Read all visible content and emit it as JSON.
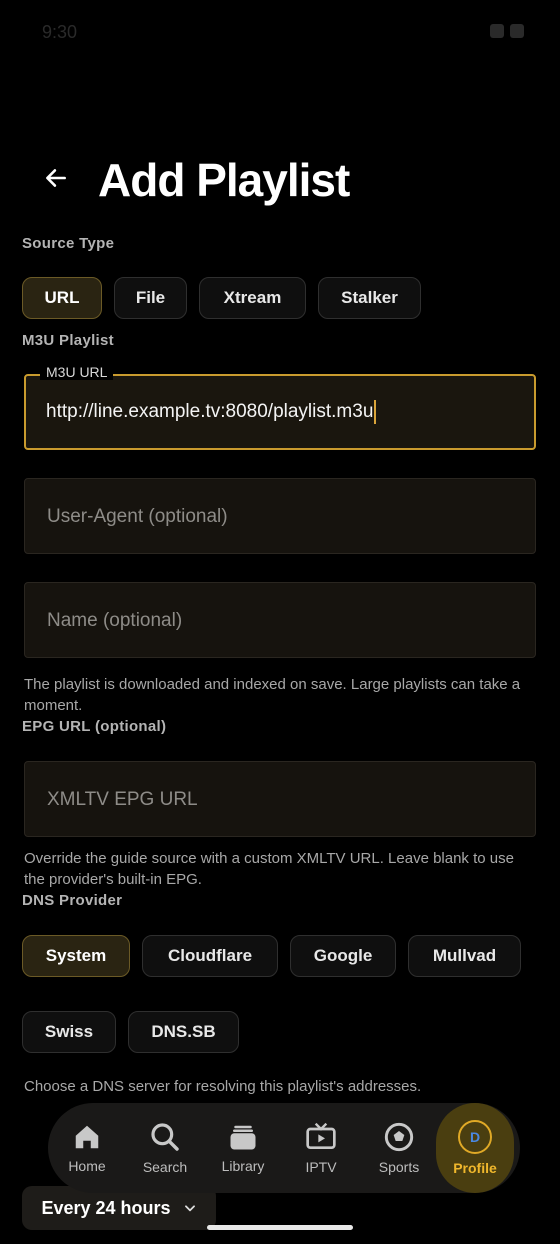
{
  "status": {
    "time": "9:30"
  },
  "header": {
    "title": "Add Playlist"
  },
  "source_type": {
    "label": "Source Type",
    "options": [
      "URL",
      "File",
      "Xtream",
      "Stalker"
    ],
    "selected": "URL"
  },
  "m3u": {
    "label": "M3U Playlist",
    "url_legend": "M3U URL",
    "url_value": "http://line.example.tv:8080/playlist.m3u",
    "user_agent_placeholder": "User-Agent (optional)",
    "name_placeholder": "Name (optional)",
    "help": "The playlist is downloaded and indexed on save. Large playlists can take a moment."
  },
  "epg": {
    "label": "EPG URL (optional)",
    "placeholder": "XMLTV EPG URL",
    "help": "Override the guide source with a custom XMLTV URL. Leave blank to use the provider's built-in EPG."
  },
  "dns": {
    "label": "DNS Provider",
    "options": [
      "System",
      "Cloudflare",
      "Google",
      "Mullvad",
      "Swiss",
      "DNS.SB"
    ],
    "selected": "System",
    "help": "Choose a DNS server for resolving this playlist's addresses."
  },
  "refresh": {
    "value": "Every 24 hours"
  },
  "nav": {
    "items": [
      {
        "label": "Home",
        "icon": "home-icon"
      },
      {
        "label": "Search",
        "icon": "search-icon"
      },
      {
        "label": "Library",
        "icon": "library-icon"
      },
      {
        "label": "IPTV",
        "icon": "tv-icon"
      },
      {
        "label": "Sports",
        "icon": "sports-icon"
      },
      {
        "label": "Profile",
        "icon": "avatar"
      }
    ],
    "active": "Profile",
    "avatar_letter": "D"
  },
  "colors": {
    "accent": "#F0B72C",
    "focus_border": "#C99B2E",
    "background": "#000000"
  }
}
